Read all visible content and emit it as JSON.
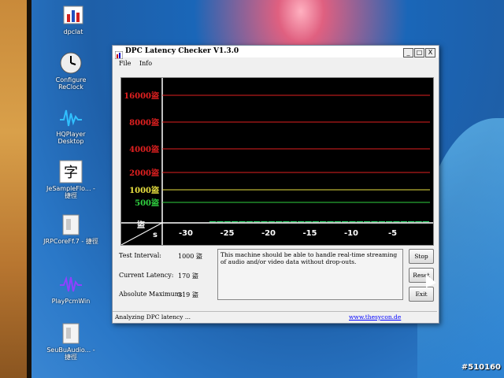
{
  "desktop": {
    "icons": [
      {
        "label": "dpclat",
        "icon": "dpclat-app-icon"
      },
      {
        "label": "Configure ReClock",
        "icon": "clock-icon"
      },
      {
        "label": "HQPlayer Desktop",
        "icon": "waveform-icon"
      },
      {
        "label": "JeSampleFlo... - 捷徑",
        "icon": "calligraphy-icon"
      },
      {
        "label": "JRPCoreFf.7 - 捷徑",
        "icon": "file-icon"
      },
      {
        "label": "PlayPcmWin",
        "icon": "waveform-icon"
      },
      {
        "label": "SeuBuAudio... - 捷徑",
        "icon": "file-icon"
      }
    ],
    "watermark": "#510160"
  },
  "window": {
    "title": "DPC Latency Checker V1.3.0",
    "menu": [
      "File",
      "Info"
    ],
    "controls": [
      "_",
      "□",
      "X"
    ]
  },
  "chart_data": {
    "type": "bar",
    "title": "",
    "y_axis_unit": "盜",
    "x_axis_unit": "s",
    "ylim": [
      0,
      16000
    ],
    "reference_lines": [
      {
        "value": 16000,
        "label": "16000盜",
        "color": "#e02020"
      },
      {
        "value": 8000,
        "label": "8000盜",
        "color": "#e02020"
      },
      {
        "value": 4000,
        "label": "4000盜",
        "color": "#e02020"
      },
      {
        "value": 2000,
        "label": "2000盜",
        "color": "#e02020"
      },
      {
        "value": 1000,
        "label": "1000盜",
        "color": "#e8e040"
      },
      {
        "value": 500,
        "label": "500盜",
        "color": "#30d040"
      }
    ],
    "x_ticks": [
      -30,
      -25,
      -20,
      -15,
      -10,
      -5
    ],
    "x": [
      -29,
      -28,
      -27,
      -26,
      -25,
      -24,
      -23,
      -22,
      -21,
      -20,
      -19,
      -18,
      -17,
      -16,
      -15,
      -14,
      -13,
      -12,
      -11,
      -10,
      -9,
      -8,
      -7,
      -6,
      -5,
      -4,
      -3,
      -2,
      -1,
      0
    ],
    "values": [
      180,
      190,
      200,
      185,
      210,
      175,
      200,
      190,
      205,
      195,
      180,
      190,
      250,
      200,
      185,
      175,
      190,
      185,
      200,
      190,
      180,
      195,
      190,
      200,
      210,
      185,
      170,
      200,
      175,
      170
    ],
    "bar_color": "#30e070",
    "grid": false
  },
  "info": {
    "test_interval_label": "Test Interval:",
    "test_interval_value": "1000 盜",
    "current_latency_label": "Current Latency:",
    "current_latency_value": "170 盜",
    "absolute_max_label": "Absolute Maximum:",
    "absolute_max_value": "319 盜",
    "message": "This machine should be able to handle real-time streaming of audio and/or video data without drop-outs."
  },
  "buttons": {
    "stop": "Stop",
    "reset": "Reset",
    "exit": "Exit"
  },
  "status": {
    "left": "Analyzing DPC latency ...",
    "right": "www.thesycon.de"
  }
}
